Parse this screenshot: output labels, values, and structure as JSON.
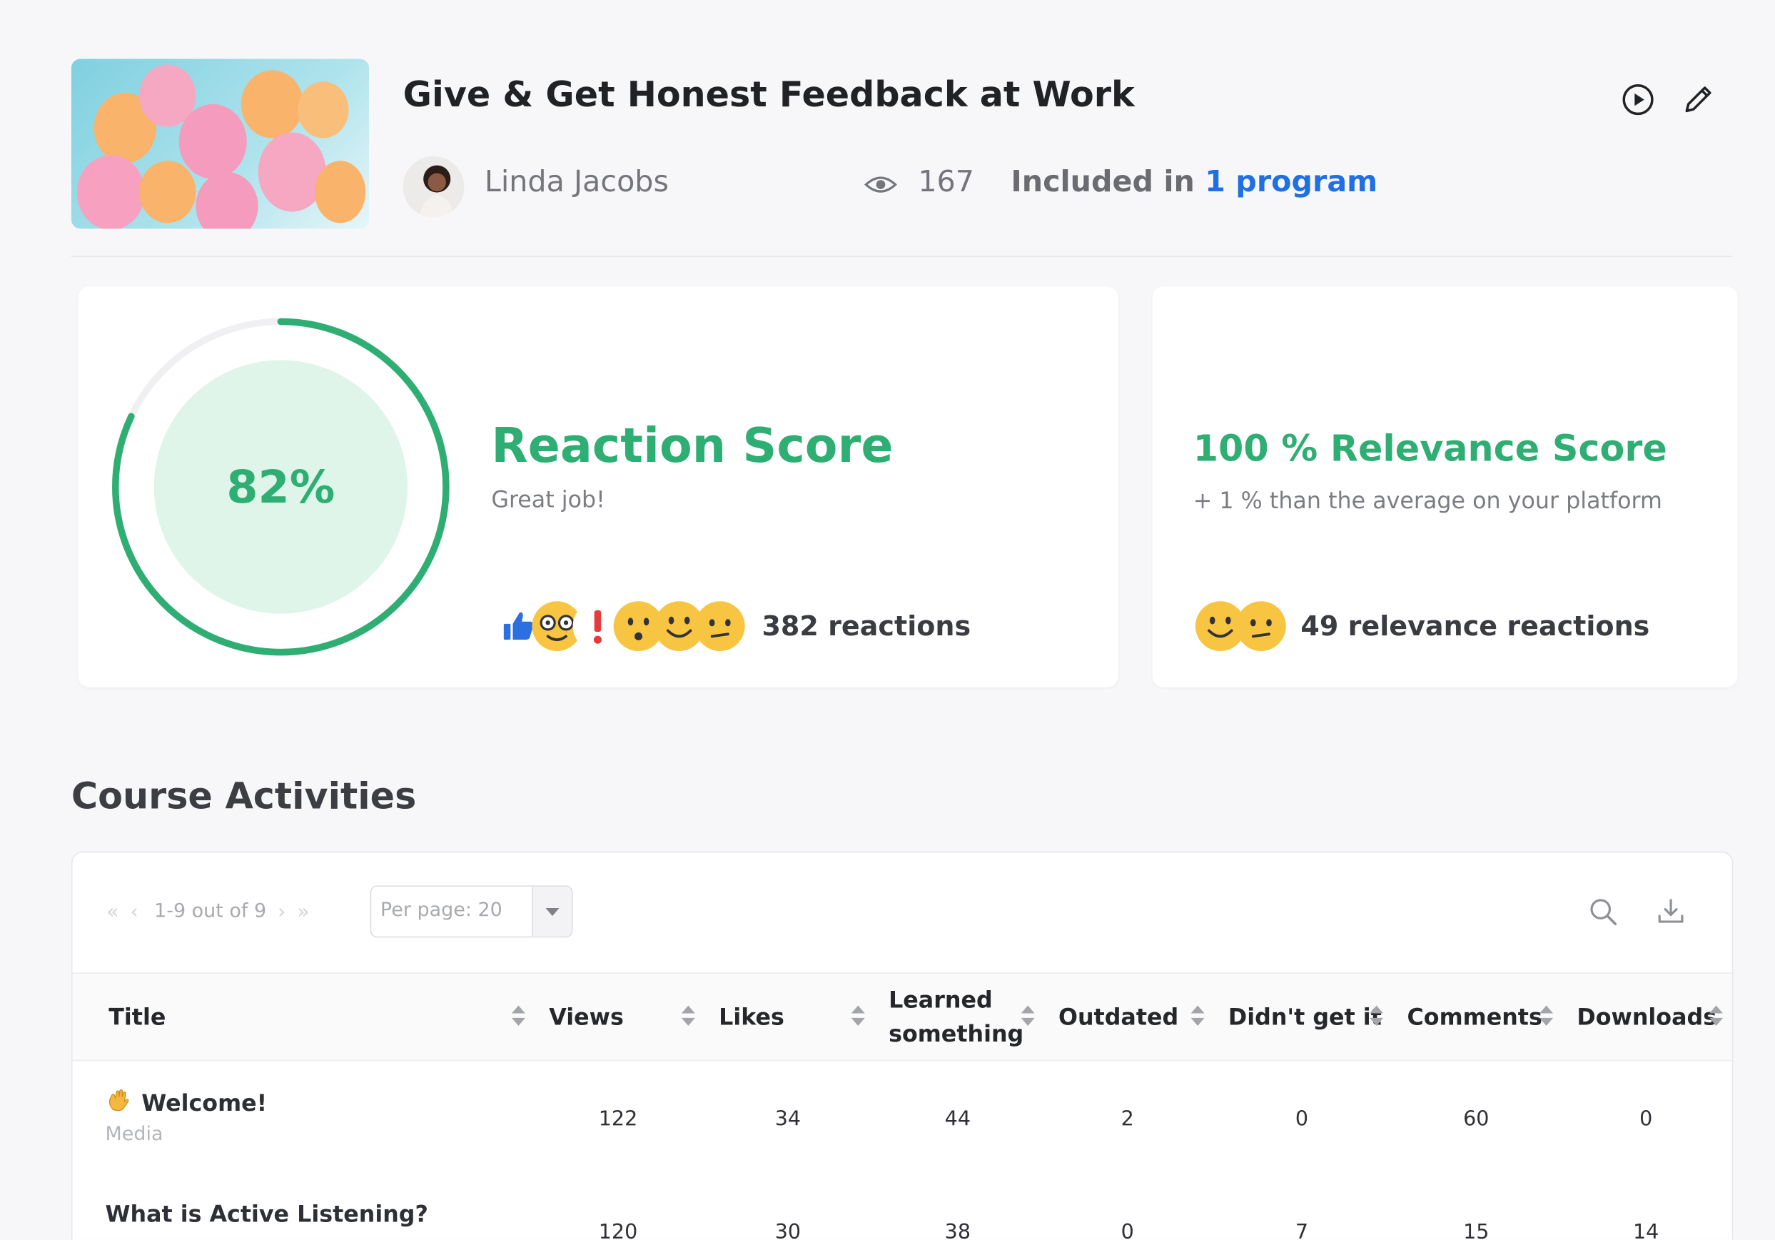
{
  "course": {
    "title": "Give & Get Honest Feedback at Work",
    "author": "Linda Jacobs",
    "views": "167",
    "included_prefix": "Included in ",
    "included_link": "1 program"
  },
  "reaction": {
    "percent_label": "82%",
    "percent_value": 82,
    "title": "Reaction Score",
    "subtitle": "Great job!",
    "count_label": "382 reactions"
  },
  "relevance": {
    "title": "100 % Relevance Score",
    "subtitle": "+ 1 % than the average on your platform",
    "count_label": "49 relevance reactions"
  },
  "activities": {
    "section_title": "Course Activities",
    "pager_text": "1-9 out of 9",
    "per_page": "Per page: 20",
    "columns": [
      "Title",
      "Views",
      "Likes",
      "Learned something",
      "Outdated",
      "Didn't get it",
      "Comments",
      "Downloads"
    ],
    "rows": [
      {
        "title": "Welcome!",
        "subtitle": "Media",
        "views": "122",
        "likes": "34",
        "learned": "44",
        "outdated": "2",
        "didnt": "0",
        "comments": "60",
        "downloads": "0"
      },
      {
        "title": "What is Active Listening?",
        "subtitle": "",
        "views": "120",
        "likes": "30",
        "learned": "38",
        "outdated": "0",
        "didnt": "7",
        "comments": "15",
        "downloads": "14"
      }
    ]
  },
  "colors": {
    "accent_green": "#2fae74",
    "link_blue": "#1f6fe5",
    "gauge_fill": "#dff5ea"
  },
  "icons": [
    "eye-icon",
    "play-circle-icon",
    "pencil-icon",
    "search-icon",
    "download-icon",
    "thumbs-up-icon",
    "waving-hand-icon"
  ]
}
